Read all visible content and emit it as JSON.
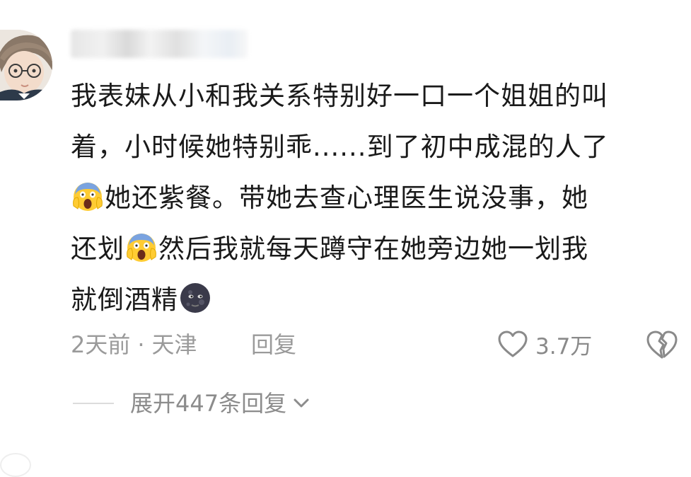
{
  "comment": {
    "author_name": "",
    "lines": [
      [
        "我表妹从小和我关系特别好一口一个姐姐的叫"
      ],
      [
        "着，小时候她特别乖......到了初中成混的人了"
      ],
      [
        "",
        "她还紫餐。带她去查心理医生说没事，她"
      ],
      [
        "还划",
        "然后我就每天蹲守在她旁边她一划我"
      ],
      [
        "就倒酒精",
        ""
      ]
    ],
    "emojis": [
      "screaming-face",
      "screaming-face",
      "new-moon-face"
    ],
    "time": "2天前",
    "separator": "·",
    "location": "天津",
    "reply_label": "回复",
    "like_count": "3.7万",
    "expand_label": "展开447条回复"
  },
  "colors": {
    "text": "#1a1a1a",
    "meta": "#9a9a9a",
    "background": "#ffffff"
  }
}
